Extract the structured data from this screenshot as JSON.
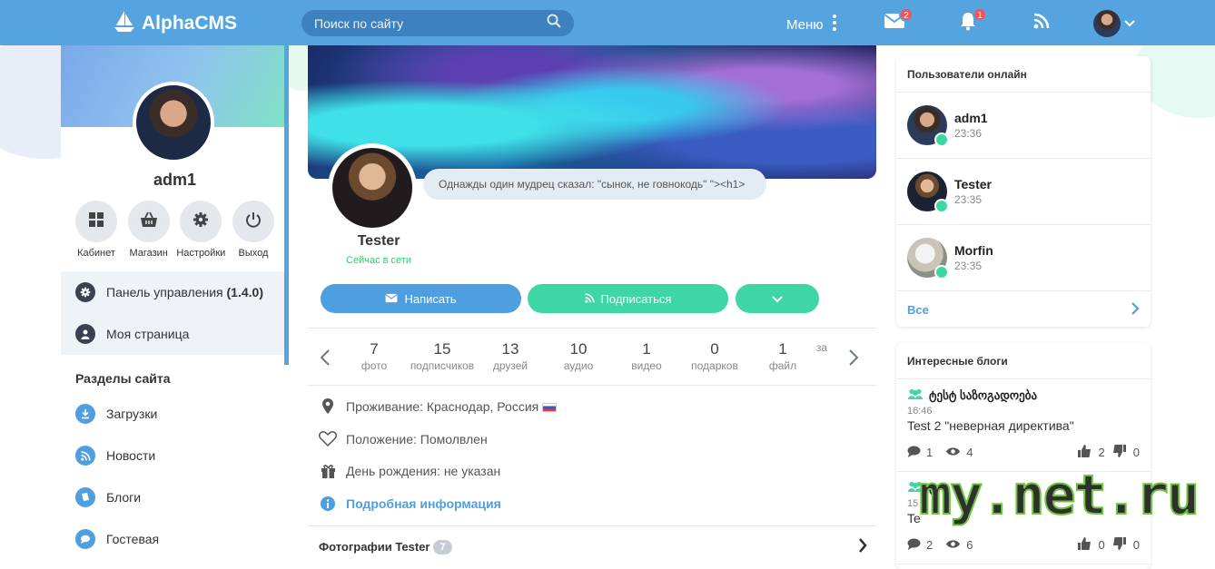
{
  "brand": {
    "name": "AlphaCMS"
  },
  "search": {
    "placeholder": "Поиск по сайту"
  },
  "topnav": {
    "menu_label": "Меню",
    "messages_count": "2",
    "notifications_count": "1"
  },
  "left": {
    "username": "adm1",
    "quick": [
      {
        "label": "Кабинет"
      },
      {
        "label": "Магазин"
      },
      {
        "label": "Настройки"
      },
      {
        "label": "Выход"
      }
    ],
    "admin_panel": {
      "label": "Панель управления",
      "version": "(1.4.0)"
    },
    "my_page": "Моя страница",
    "sections_title": "Разделы сайта",
    "sections": [
      "Загрузки",
      "Новости",
      "Блоги",
      "Гостевая"
    ]
  },
  "profile": {
    "name": "Tester",
    "online_status": "Сейчас в сети",
    "status_text": "Однажды один мудрец сказал: \"сынок, не говнокодь\" \"><h1>",
    "buttons": {
      "write": "Написать",
      "subscribe": "Подписаться"
    },
    "stats": [
      {
        "n": "7",
        "l": "фото"
      },
      {
        "n": "15",
        "l": "подписчиков"
      },
      {
        "n": "13",
        "l": "друзей"
      },
      {
        "n": "10",
        "l": "аудио"
      },
      {
        "n": "1",
        "l": "видео"
      },
      {
        "n": "0",
        "l": "подарков"
      },
      {
        "n": "1",
        "l": "файл"
      },
      {
        "n": "",
        "l": "за"
      }
    ],
    "info": {
      "residence": "Проживание: Краснодар, Россия",
      "relationship": "Положение: Помолвлен",
      "birthday": "День рождения: не указан",
      "details": "Подробная информация"
    },
    "photos": {
      "label": "Фотографии Tester",
      "count": "7"
    }
  },
  "online_users": {
    "title": "Пользователи онлайн",
    "users": [
      {
        "name": "adm1",
        "time": "23:36"
      },
      {
        "name": "Tester",
        "time": "23:35"
      },
      {
        "name": "Morfin",
        "time": "23:35"
      }
    ],
    "all_label": "Все"
  },
  "blogs": {
    "title": "Интересные блоги",
    "items": [
      {
        "title": "ტესტ საზოგადოება",
        "time": "16:46",
        "text": "Test 2 \"неверная директива\"",
        "comments": "1",
        "views": "4",
        "likes": "2",
        "dislikes": "0"
      },
      {
        "title": "ტ",
        "time": "15",
        "text": "Te",
        "comments": "2",
        "views": "6",
        "likes": "0",
        "dislikes": "0"
      }
    ]
  },
  "watermark": {
    "text": "my.net.ru"
  },
  "colors": {
    "primary": "#55a4e0",
    "accent": "#3ed6a5",
    "badge": "#f2545b"
  }
}
